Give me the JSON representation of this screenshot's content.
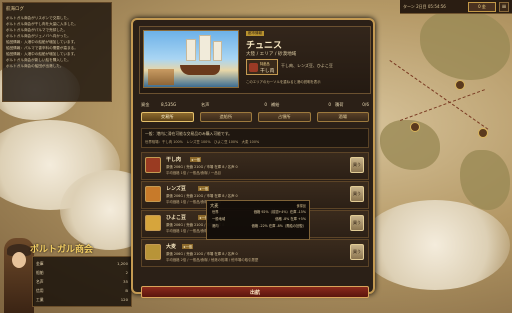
{
  "topbar": {
    "time": "ターン 2日目 05:54:56",
    "gold_label": "0 金",
    "menu_label": "≡"
  },
  "log": {
    "title": "航海ログ",
    "lines": [
      "ポルトガル商会がリスボンで交易した。",
      "ポルトガル商会が干し肉を大量に入手した。",
      "ポルトガル商会がパルマで売却した。",
      "ポルトガル商会がジェノバへ向かった。",
      "船団情報：入港中の船舶が増加しています。",
      "船団情報：パルマで香辛料の需要が高まる。",
      "船団情報：入港中の船舶が増加しています。",
      "ポルトガル商会が新しい船を購入した。",
      "ポルトガル商会の船団が出港した。"
    ]
  },
  "company": {
    "name": "ポルトガル商会",
    "stats": [
      {
        "k": "金庫",
        "v": "1,200"
      },
      {
        "k": "船舶",
        "v": "2"
      },
      {
        "k": "名声",
        "v": "35"
      },
      {
        "k": "信用",
        "v": "B"
      },
      {
        "k": "工業",
        "v": "120"
      }
    ]
  },
  "dialog": {
    "badge": "都市情報",
    "city": "チュニス",
    "region": "大陸 / エリア / 砂漠地域",
    "special_label": "特産品",
    "special_value": "干し肉",
    "trade_items": "干し肉、レンズ豆、ひよこ豆",
    "desc": "このエリアのカーソルを重ねると港の説明を表示",
    "stat_line": {
      "money_label": "資金",
      "money_value": "8,535G",
      "fame_label": "名声",
      "fame_value": "0",
      "supply_label": "補給",
      "supply_value": "0",
      "cargo_label": "積荷",
      "cargo_value": "0/6"
    },
    "tabs": [
      "交易所",
      "造船所",
      "占領所",
      "酒場"
    ],
    "info_line1": "一般：港内に滞在可能な交易品のみ購入可能です。",
    "info_line2": "世界相場：干し肉 100%　レンズ豆 100%　ひよこ豆 100%　大麦 100%",
    "goods": [
      {
        "name": "干し肉",
        "tag": "★一般",
        "l1": "原価 206G / 売値 210G / 市場 在庫 8 / 名声 0",
        "l2": "平均価格 1倍 / 一般品/食糧 / 一品目",
        "btn": "買う",
        "color": "#9a3b22"
      },
      {
        "name": "レンズ豆",
        "tag": "★一般",
        "l1": "原価 206G / 売値 210G / 市場 在庫 8 / 名声 0",
        "l2": "平均価格 1倍 / 一般品/食糧 / 一品目",
        "btn": "買う",
        "color": "#c77a2a"
      },
      {
        "name": "ひよこ豆",
        "tag": "★一般",
        "l1": "原価 206G / 売値 210G / 市場 在庫 8",
        "l2": "平均価格 1倍 / 一般品/食糧",
        "btn": "買う",
        "color": "#d6a53c"
      },
      {
        "name": "大麦",
        "tag": "★一般",
        "l1": "原価 206G / 売値 210G / 市場 在庫 8 / 名声 0",
        "l2": "平均価格 2倍 / 一般品/食糧 / 他港の相場 / 他市場の取引履歴",
        "btn": "買う",
        "color": "#b89438"
      }
    ],
    "tooltip": {
      "title": "大麦",
      "tag": "食糧品",
      "rows": [
        {
          "k": "世界",
          "v": "価格 92%（前週+4%）在庫 -15%"
        },
        {
          "k": "一般地域",
          "v": "価格 -8% 在庫 +5%"
        },
        {
          "k": "港内",
          "v": "価格 -22% 在庫 -8%（需給の回復）"
        }
      ]
    },
    "close_label": "出航"
  }
}
